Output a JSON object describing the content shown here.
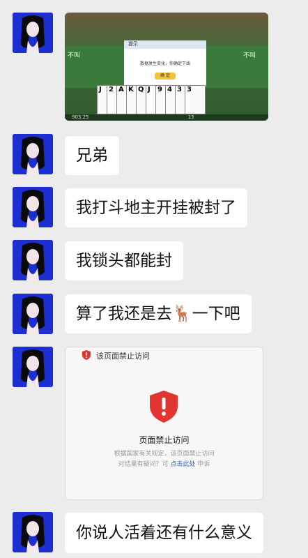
{
  "messages": [
    {
      "type": "image",
      "image": "game-screenshot"
    },
    {
      "type": "text",
      "text": "兄弟"
    },
    {
      "type": "text",
      "text": "我打斗地主开挂被封了"
    },
    {
      "type": "text",
      "text": "我锁头都能封"
    },
    {
      "type": "text",
      "text": "算了我还是去🦌一下吧"
    },
    {
      "type": "blocked_page"
    },
    {
      "type": "text",
      "text": "你说人活着还有什么意义"
    }
  ],
  "game": {
    "dialog_title": "提示",
    "dialog_message": "数据发生变化，你确定下线",
    "confirm_label": "确 定",
    "cards": [
      "J",
      "O",
      "K",
      "E",
      "R",
      "2",
      "A",
      "K",
      "Q",
      "J",
      "9",
      "4",
      "3",
      "3"
    ],
    "bottom_value": "903.25",
    "bottom_value_2": "15",
    "side_left": "不叫",
    "side_right": "不叫"
  },
  "blocked": {
    "bar_title": "该页面禁止访问",
    "title": "页面禁止访问",
    "desc_line1": "根据国家有关规定，该页面禁止访问",
    "desc_line2_prefix": "对结果有疑问？可",
    "link": "点击此处",
    "desc_line2_suffix": "申诉"
  },
  "colors": {
    "background": "#ececec",
    "bubble": "#ffffff",
    "avatar": "#1d2fd0",
    "alert": "#e0362f",
    "link": "#2f5fc0"
  }
}
